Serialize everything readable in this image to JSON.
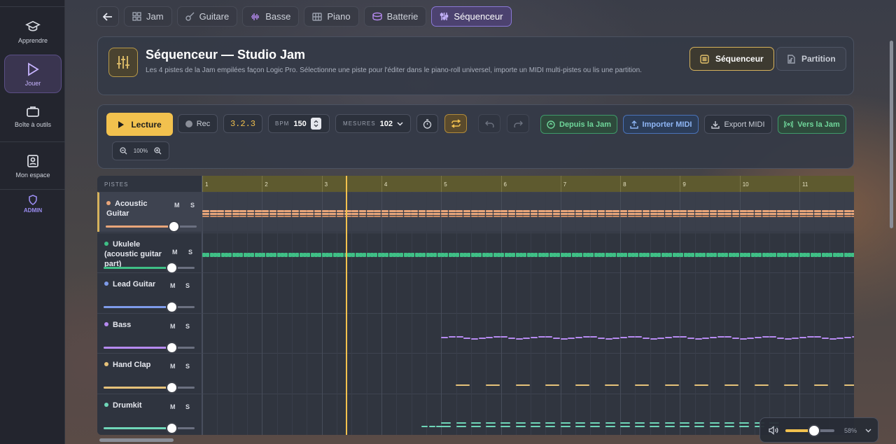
{
  "sidebar": {
    "items": [
      {
        "label": "Apprendre",
        "icon": "graduation-cap-icon"
      },
      {
        "label": "Jouer",
        "icon": "play-icon"
      },
      {
        "label": "Boîte à outils",
        "icon": "briefcase-icon"
      },
      {
        "label": "Mon espace",
        "icon": "contact-book-icon"
      },
      {
        "label": "ADMIN",
        "icon": "shield-icon"
      }
    ]
  },
  "topnav": {
    "tabs": [
      {
        "label": "Jam",
        "icon": "grid-icon"
      },
      {
        "label": "Guitare",
        "icon": "guitar-icon"
      },
      {
        "label": "Basse",
        "icon": "waveform-icon"
      },
      {
        "label": "Piano",
        "icon": "piano-icon"
      },
      {
        "label": "Batterie",
        "icon": "drum-icon"
      },
      {
        "label": "Séquenceur",
        "icon": "sliders-icon"
      }
    ]
  },
  "header": {
    "title": "Séquenceur — Studio Jam",
    "description": "Les 4 pistes de la Jam empilées façon Logic Pro. Sélectionne une piste pour l'éditer dans le piano-roll universel, importe un MIDI multi-pistes ou lis une partition.",
    "view_sequencer": "Séquenceur",
    "view_score": "Partition"
  },
  "transport": {
    "play": "Lecture",
    "rec": "Rec",
    "position": "3.2.3",
    "bpm_label": "BPM",
    "bpm": "150",
    "measures_label": "MESURES",
    "measures": "102",
    "from_jam": "Depuis la Jam",
    "import_midi": "Importer MIDI",
    "export_midi": "Export MIDI",
    "to_jam": "Vers la Jam",
    "zoom": "100%"
  },
  "tracks_header": "PISTES",
  "tracks": [
    {
      "name": "Acoustic Guitar",
      "color": "#e8a57a",
      "mute": "M",
      "solo": "S",
      "volume": 0.75,
      "selected": true
    },
    {
      "name": "Ukulele (acoustic guitar part)",
      "color": "#3fbf86",
      "mute": "M",
      "solo": "S",
      "volume": 0.75
    },
    {
      "name": "Lead Guitar",
      "color": "#7e9bea",
      "mute": "M",
      "solo": "S",
      "volume": 0.75
    },
    {
      "name": "Bass",
      "color": "#b68af0",
      "mute": "M",
      "solo": "S",
      "volume": 0.75
    },
    {
      "name": "Hand Clap",
      "color": "#e6c27a",
      "mute": "M",
      "solo": "S",
      "volume": 0.75
    },
    {
      "name": "Drumkit",
      "color": "#6fd6b8",
      "mute": "M",
      "solo": "S",
      "volume": 0.75
    }
  ],
  "ruler": [
    "1",
    "2",
    "3",
    "4",
    "5",
    "6",
    "7",
    "8",
    "9",
    "10",
    "11"
  ],
  "master_volume": "58%"
}
